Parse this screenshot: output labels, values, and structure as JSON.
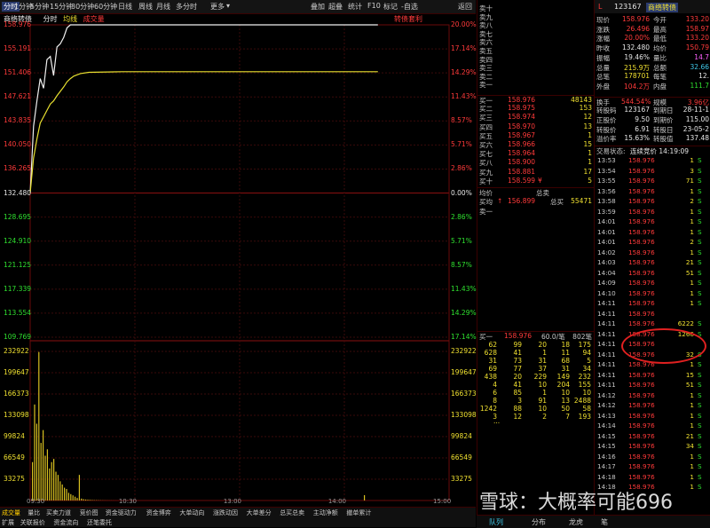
{
  "toolbar": {
    "items": [
      "分时",
      "1分钟",
      "5分钟",
      "15分钟",
      "30分钟",
      "60分钟",
      "日线",
      "周线",
      "月线",
      "多分时",
      "更多"
    ],
    "active": "分时",
    "right_items": [
      "叠加",
      "超叠",
      "统计",
      "F10",
      "标记",
      "-自选",
      "返回"
    ],
    "dropdown_marker": "▾"
  },
  "chart": {
    "stock_name": "商络转债",
    "legend": [
      "分时",
      "均线",
      "成交量"
    ],
    "premium_label": "转债套利",
    "price_labels": [
      "158.976",
      "155.191",
      "151.406",
      "147.621",
      "143.835",
      "140.050",
      "136.265",
      "132.480",
      "128.695",
      "124.910",
      "121.125",
      "117.339",
      "113.554",
      "109.769"
    ],
    "pct_labels": [
      "20.00%",
      "17.14%",
      "14.29%",
      "11.43%",
      "8.57%",
      "5.71%",
      "2.86%",
      "0.00%",
      "2.86%",
      "5.71%",
      "8.57%",
      "11.43%",
      "14.29%",
      "17.14%"
    ],
    "vol_labels": [
      "232922",
      "199647",
      "166373",
      "133098",
      "99824",
      "66549",
      "33275"
    ],
    "time_labels": [
      "09:30",
      "10:30",
      "13:00",
      "14:00",
      "15:00"
    ]
  },
  "chart_data": {
    "type": "line",
    "x": [
      "09:30",
      "09:33",
      "09:36",
      "09:39",
      "09:42",
      "09:45",
      "09:48",
      "09:51",
      "09:54",
      "09:57",
      "10:00",
      "10:03",
      "10:06",
      "10:09",
      "10:12",
      "10:15",
      "10:30",
      "11:00",
      "13:00",
      "14:00",
      "15:00"
    ],
    "series": [
      {
        "values": [
          132.48,
          143.0,
          147.0,
          150.5,
          149.0,
          153.5,
          154.0,
          151.0,
          155.5,
          156.0,
          157.0,
          158.5,
          158.976,
          158.976,
          158.976,
          158.976,
          158.976,
          158.976,
          158.976,
          158.976,
          158.976
        ]
      },
      {
        "values": [
          132.48,
          138.0,
          141.0,
          143.5,
          144.5,
          145.5,
          146.5,
          147.0,
          147.8,
          148.5,
          149.2,
          150.0,
          150.5,
          150.9,
          151.1,
          151.3,
          151.5,
          151.6,
          151.6,
          151.6,
          151.6
        ]
      }
    ],
    "volume": [
      60000,
      150000,
      120000,
      232000,
      90000,
      110000,
      70000,
      80000,
      50000,
      60000,
      65000,
      45000,
      40000,
      30000,
      25000,
      20000,
      18000,
      12000,
      10000,
      8000,
      6000,
      4000,
      40000,
      3000,
      2000,
      1500,
      1200,
      1000,
      800,
      600,
      500,
      400,
      300,
      250,
      200,
      150,
      120,
      100,
      80,
      60
    ],
    "ylim": [
      109.769,
      158.976
    ],
    "vlim": [
      0,
      232922
    ]
  },
  "orderbook": {
    "sell": [
      {
        "label": "卖十",
        "price": "",
        "vol": ""
      },
      {
        "label": "卖九",
        "price": "",
        "vol": ""
      },
      {
        "label": "卖八",
        "price": "",
        "vol": ""
      },
      {
        "label": "卖七",
        "price": "",
        "vol": ""
      },
      {
        "label": "卖六",
        "price": "",
        "vol": ""
      },
      {
        "label": "卖五",
        "price": "",
        "vol": ""
      },
      {
        "label": "卖四",
        "price": "",
        "vol": ""
      },
      {
        "label": "卖三",
        "price": "",
        "vol": ""
      },
      {
        "label": "卖二",
        "price": "",
        "vol": ""
      },
      {
        "label": "卖一",
        "price": "",
        "vol": ""
      }
    ],
    "buy": [
      {
        "label": "买一",
        "price": "158.976",
        "vol": "48143"
      },
      {
        "label": "买二",
        "price": "158.975",
        "vol": "153"
      },
      {
        "label": "买三",
        "price": "158.974",
        "vol": "12"
      },
      {
        "label": "买四",
        "price": "158.970",
        "vol": "13"
      },
      {
        "label": "买五",
        "price": "158.967",
        "vol": "1"
      },
      {
        "label": "买六",
        "price": "158.966",
        "vol": "15"
      },
      {
        "label": "买七",
        "price": "158.964",
        "vol": "1"
      },
      {
        "label": "买八",
        "price": "158.900",
        "vol": "1"
      },
      {
        "label": "买九",
        "price": "158.881",
        "vol": "17"
      },
      {
        "label": "买十",
        "price": "158.599",
        "vol": "5"
      }
    ],
    "buy10_flag": "¥",
    "avg_label": "均价",
    "total_sell_label": "总卖",
    "avg_buy_label": "买均",
    "avg_buy": "156.899",
    "total_buy_label": "总买",
    "total_buy_arrow": "↑",
    "total_buy": "55471",
    "sell1_label": "卖一",
    "queue_header": {
      "label": "买一",
      "price": "158.976",
      "avg": "60.0/笔",
      "count": "802笔"
    },
    "queue_rows": [
      [
        "62",
        "99",
        "20",
        "18",
        "175"
      ],
      [
        "628",
        "41",
        "1",
        "11",
        "94"
      ],
      [
        "31",
        "73",
        "31",
        "68",
        "5"
      ],
      [
        "69",
        "77",
        "37",
        "31",
        "34"
      ],
      [
        "438",
        "20",
        "229",
        "149",
        "232"
      ],
      [
        "4",
        "41",
        "10",
        "204",
        "155"
      ],
      [
        "6",
        "85",
        "1",
        "10",
        "10"
      ],
      [
        "8",
        "3",
        "91",
        "13",
        "2488"
      ],
      [
        "1242",
        "88",
        "10",
        "50",
        "58"
      ],
      [
        "3",
        "12",
        "2",
        "7",
        "193"
      ]
    ],
    "queue_more": "..."
  },
  "right_panel": {
    "code": "123167",
    "name": "商络转债",
    "flag": "L",
    "quotes": [
      {
        "k1": "现价",
        "v1": "158.976",
        "k2": "今开",
        "v2": "133.20"
      },
      {
        "k1": "涨跌",
        "v1": "26.496",
        "k2": "最高",
        "v2": "158.97"
      },
      {
        "k1": "涨幅",
        "v1": "20.00%",
        "k2": "最低",
        "v2": "133.20"
      },
      {
        "k1": "昨收",
        "v1": "132.480",
        "k2": "均价",
        "v2": "150.79"
      },
      {
        "k1": "振幅",
        "v1": "19.46%",
        "k2": "量比",
        "v2": "14.7"
      },
      {
        "k1": "总量",
        "v1": "215.9万",
        "k2": "总额",
        "v2": "32.66"
      },
      {
        "k1": "总笔",
        "v1": "178701",
        "k2": "每笔",
        "v2": "12."
      },
      {
        "k1": "外盘",
        "v1": "104.2万",
        "k2": "内盘",
        "v2": "111.7"
      },
      {
        "k1": "换手",
        "v1": "544.54%",
        "k2": "规模",
        "v2": "3.96亿"
      },
      {
        "k1": "转股码",
        "v1": "123167",
        "k2": "到期日",
        "v2": "28-11-1"
      },
      {
        "k1": "正股价",
        "v1": "9.50",
        "k2": "到期价",
        "v2": "115.00"
      },
      {
        "k1": "转股价",
        "v1": "6.91",
        "k2": "转股日",
        "v2": "23-05-2"
      },
      {
        "k1": "溢价率",
        "v1": "15.63%",
        "k2": "转股值",
        "v2": "137.48"
      }
    ],
    "status_label": "交易状态:",
    "status_value": "连续竞价 14:19:09",
    "ticks": [
      {
        "t": "13:53",
        "p": "158.976",
        "v": "1",
        "s": "S"
      },
      {
        "t": "13:54",
        "p": "158.976",
        "v": "3",
        "s": "S"
      },
      {
        "t": "13:55",
        "p": "158.976",
        "v": "71",
        "s": "S"
      },
      {
        "t": "13:56",
        "p": "158.976",
        "v": "1",
        "s": "S"
      },
      {
        "t": "13:58",
        "p": "158.976",
        "v": "2",
        "s": "S"
      },
      {
        "t": "13:59",
        "p": "158.976",
        "v": "1",
        "s": "S"
      },
      {
        "t": "14:01",
        "p": "158.976",
        "v": "1",
        "s": "S"
      },
      {
        "t": "14:01",
        "p": "158.976",
        "v": "1",
        "s": "S"
      },
      {
        "t": "14:01",
        "p": "158.976",
        "v": "2",
        "s": "S"
      },
      {
        "t": "14:02",
        "p": "158.976",
        "v": "1",
        "s": "S"
      },
      {
        "t": "14:03",
        "p": "158.976",
        "v": "21",
        "s": "S"
      },
      {
        "t": "14:04",
        "p": "158.976",
        "v": "51",
        "s": "S"
      },
      {
        "t": "14:09",
        "p": "158.976",
        "v": "1",
        "s": "S"
      },
      {
        "t": "14:10",
        "p": "158.976",
        "v": "1",
        "s": "S"
      },
      {
        "t": "14:11",
        "p": "158.976",
        "v": "1",
        "s": "S"
      },
      {
        "t": "14:11",
        "p": "158.976",
        "v": "",
        "s": ""
      },
      {
        "t": "14:11",
        "p": "158.976",
        "v": "6222",
        "s": "S"
      },
      {
        "t": "14:11",
        "p": "158.976",
        "v": "1266",
        "s": "S"
      },
      {
        "t": "14:11",
        "p": "158.976",
        "v": "",
        "s": ""
      },
      {
        "t": "14:11",
        "p": "158.976",
        "v": "32",
        "s": "S"
      },
      {
        "t": "14:11",
        "p": "158.976",
        "v": "1",
        "s": "S"
      },
      {
        "t": "14:11",
        "p": "158.976",
        "v": "15",
        "s": "S"
      },
      {
        "t": "14:11",
        "p": "158.976",
        "v": "51",
        "s": "S"
      },
      {
        "t": "14:12",
        "p": "158.976",
        "v": "1",
        "s": "S"
      },
      {
        "t": "14:12",
        "p": "158.976",
        "v": "1",
        "s": "S"
      },
      {
        "t": "14:13",
        "p": "158.976",
        "v": "1",
        "s": "S"
      },
      {
        "t": "14:14",
        "p": "158.976",
        "v": "1",
        "s": "S"
      },
      {
        "t": "14:15",
        "p": "158.976",
        "v": "21",
        "s": "S"
      },
      {
        "t": "14:15",
        "p": "158.976",
        "v": "34",
        "s": "S"
      },
      {
        "t": "14:16",
        "p": "158.976",
        "v": "1",
        "s": "S"
      },
      {
        "t": "14:17",
        "p": "158.976",
        "v": "1",
        "s": "S"
      },
      {
        "t": "14:18",
        "p": "158.976",
        "v": "1",
        "s": "S"
      },
      {
        "t": "14:18",
        "p": "158.976",
        "v": "1",
        "s": "S"
      }
    ]
  },
  "bottom_tabs": [
    "成交量",
    "量比",
    "买卖力道",
    "竞价图",
    "资金驱动力",
    "资金博弈",
    "大单动向",
    "涨跌动因",
    "大单差分",
    "总买总卖",
    "主动净额",
    "撤单累计"
  ],
  "bottom_tabs2": [
    "扩展",
    "关联报价",
    "资金流向",
    "还笔委托"
  ],
  "right_tabs": [
    "队列",
    "分布",
    "龙虎",
    "笔"
  ],
  "watermark": "雪球：大概率可能696"
}
